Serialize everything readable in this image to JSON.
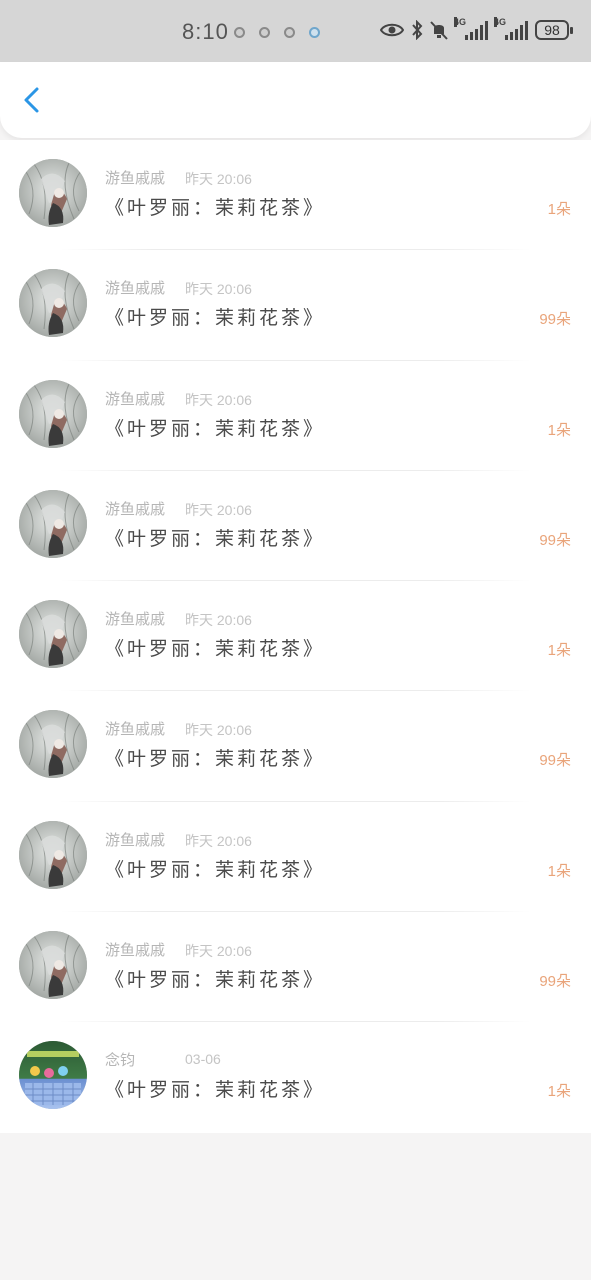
{
  "status_bar": {
    "time": "8:10",
    "signal_label": "4G",
    "battery": "98"
  },
  "header": {
    "back_icon": "chevron-left-icon",
    "accent_color": "#2b96e6"
  },
  "messages": [
    {
      "sender": "游鱼戚戚",
      "time": "昨天 20:06",
      "title": "《叶罗丽：茉莉花茶》",
      "count": "1朵",
      "avatar": "sketch"
    },
    {
      "sender": "游鱼戚戚",
      "time": "昨天 20:06",
      "title": "《叶罗丽：茉莉花茶》",
      "count": "99朵",
      "avatar": "sketch"
    },
    {
      "sender": "游鱼戚戚",
      "time": "昨天 20:06",
      "title": "《叶罗丽：茉莉花茶》",
      "count": "1朵",
      "avatar": "sketch"
    },
    {
      "sender": "游鱼戚戚",
      "time": "昨天 20:06",
      "title": "《叶罗丽：茉莉花茶》",
      "count": "99朵",
      "avatar": "sketch"
    },
    {
      "sender": "游鱼戚戚",
      "time": "昨天 20:06",
      "title": "《叶罗丽：茉莉花茶》",
      "count": "1朵",
      "avatar": "sketch"
    },
    {
      "sender": "游鱼戚戚",
      "time": "昨天 20:06",
      "title": "《叶罗丽：茉莉花茶》",
      "count": "99朵",
      "avatar": "sketch"
    },
    {
      "sender": "游鱼戚戚",
      "time": "昨天 20:06",
      "title": "《叶罗丽：茉莉花茶》",
      "count": "1朵",
      "avatar": "sketch"
    },
    {
      "sender": "游鱼戚戚",
      "time": "昨天 20:06",
      "title": "《叶罗丽：茉莉花茶》",
      "count": "99朵",
      "avatar": "sketch"
    },
    {
      "sender": "念钧",
      "time": "03-06",
      "title": "《叶罗丽：茉莉花茶》",
      "count": "1朵",
      "avatar": "game"
    }
  ],
  "colors": {
    "count": "#e9a47a",
    "sender": "#b5b5b5",
    "title": "#4a4a4a",
    "background": "#f5f4f4"
  }
}
